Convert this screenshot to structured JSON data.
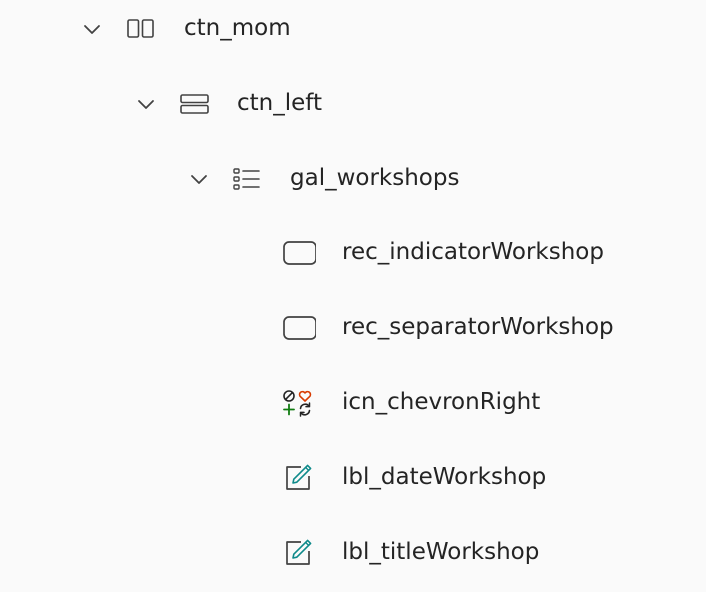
{
  "tree": {
    "nodes": [
      {
        "label": "ctn_mom",
        "icon": "horizontal-container-icon",
        "expanded": true
      },
      {
        "label": "ctn_left",
        "icon": "vertical-container-icon",
        "expanded": true
      },
      {
        "label": "gal_workshops",
        "icon": "gallery-icon",
        "expanded": true
      },
      {
        "label": "rec_indicatorWorkshop",
        "icon": "rectangle-icon"
      },
      {
        "label": "rec_separatorWorkshop",
        "icon": "rectangle-icon"
      },
      {
        "label": "icn_chevronRight",
        "icon": "icons-control-icon"
      },
      {
        "label": "lbl_dateWorkshop",
        "icon": "text-label-icon"
      },
      {
        "label": "lbl_titleWorkshop",
        "icon": "text-label-icon"
      }
    ]
  },
  "colors": {
    "text": "#242424",
    "icon_stroke": "#424242",
    "label_pen": "#0e8a8a",
    "icon_red": "#d83b01",
    "icon_green": "#107c10",
    "background": "#fafafa"
  }
}
